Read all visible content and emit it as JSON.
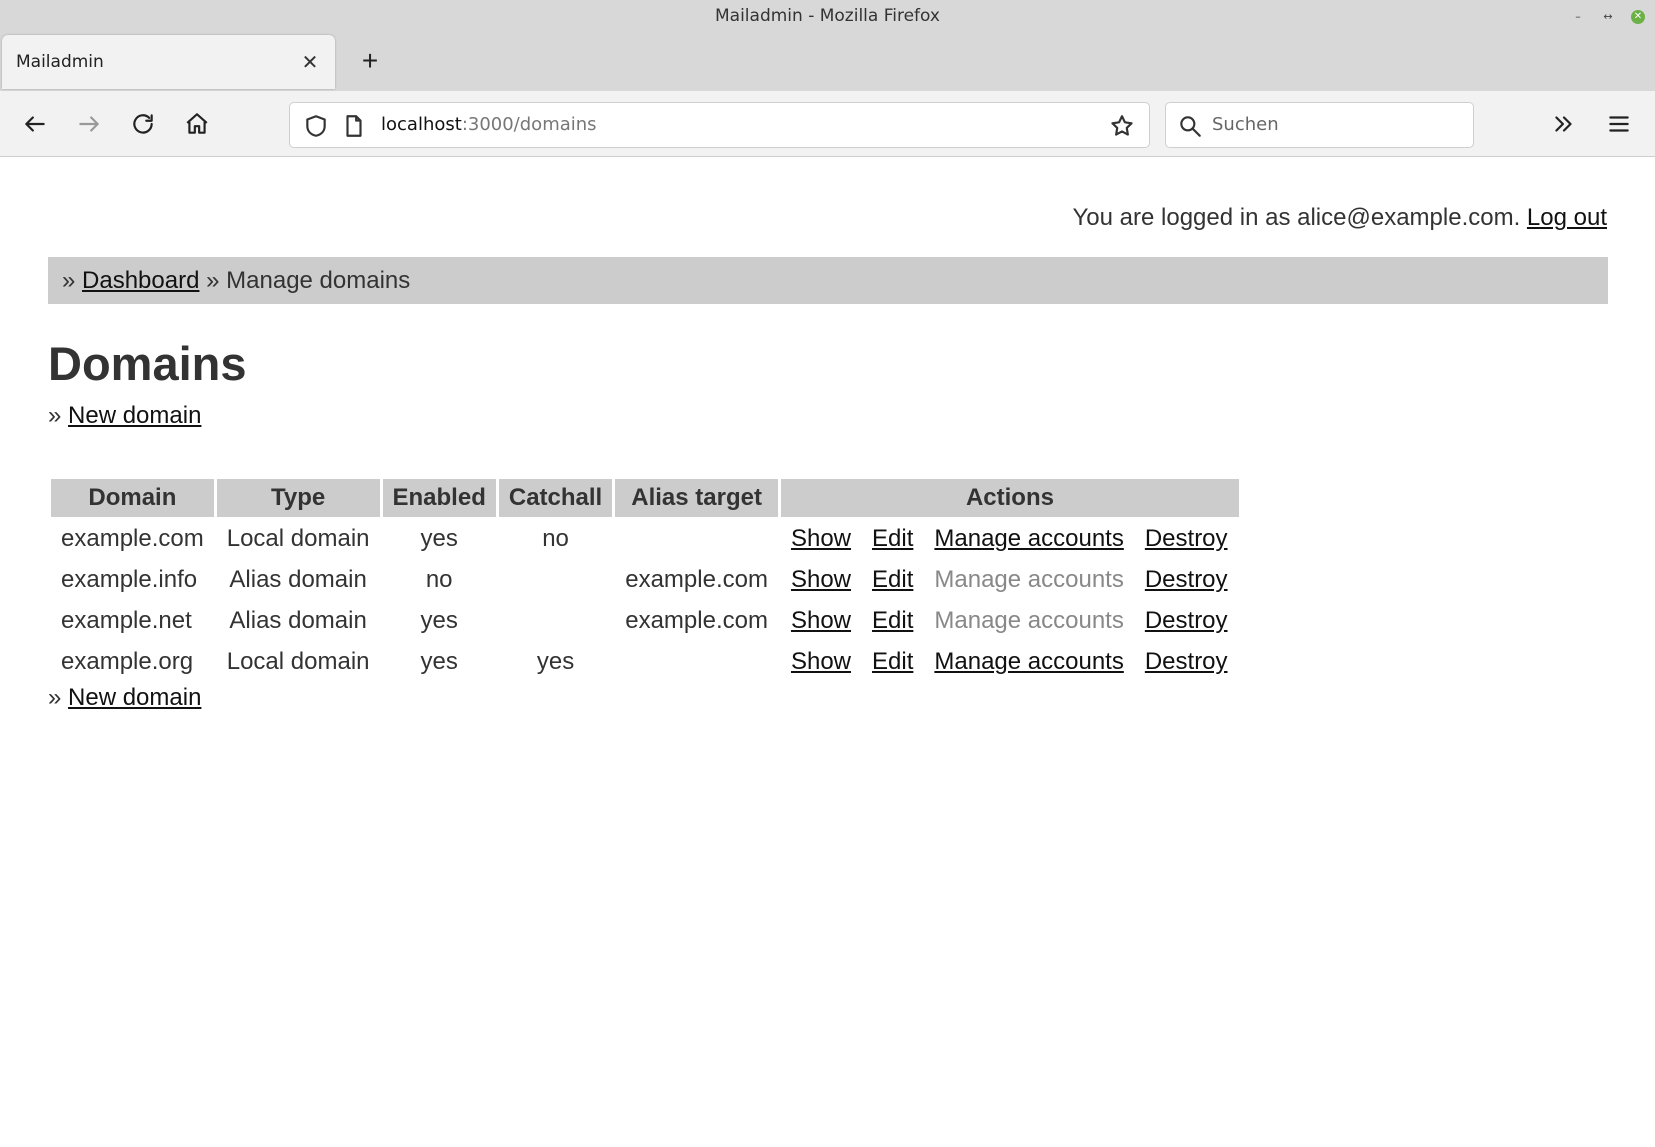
{
  "window": {
    "title": "Mailadmin - Mozilla Firefox"
  },
  "tabs": [
    {
      "title": "Mailadmin"
    }
  ],
  "toolbar": {
    "url_host": "localhost",
    "url_path": ":3000/domains",
    "search_placeholder": "Suchen"
  },
  "header": {
    "login_text": "You are logged in as alice@example.com.",
    "logout_label": "Log out"
  },
  "breadcrumb": {
    "sep1": "»",
    "dashboard_label": "Dashboard",
    "sep2": "»",
    "current": "Manage domains"
  },
  "page": {
    "title": "Domains",
    "new_prefix": "»",
    "new_domain_label": "New domain"
  },
  "table": {
    "headers": [
      "Domain",
      "Type",
      "Enabled",
      "Catchall",
      "Alias target",
      "Actions"
    ],
    "action_labels": {
      "show": "Show",
      "edit": "Edit",
      "manage": "Manage accounts",
      "destroy": "Destroy"
    },
    "rows": [
      {
        "domain": "example.com",
        "type": "Local domain",
        "enabled": "yes",
        "catchall": "no",
        "alias_target": "",
        "manage_enabled": true
      },
      {
        "domain": "example.info",
        "type": "Alias domain",
        "enabled": "no",
        "catchall": "",
        "alias_target": "example.com",
        "manage_enabled": false
      },
      {
        "domain": "example.net",
        "type": "Alias domain",
        "enabled": "yes",
        "catchall": "",
        "alias_target": "example.com",
        "manage_enabled": false
      },
      {
        "domain": "example.org",
        "type": "Local domain",
        "enabled": "yes",
        "catchall": "yes",
        "alias_target": "",
        "manage_enabled": true
      }
    ]
  }
}
